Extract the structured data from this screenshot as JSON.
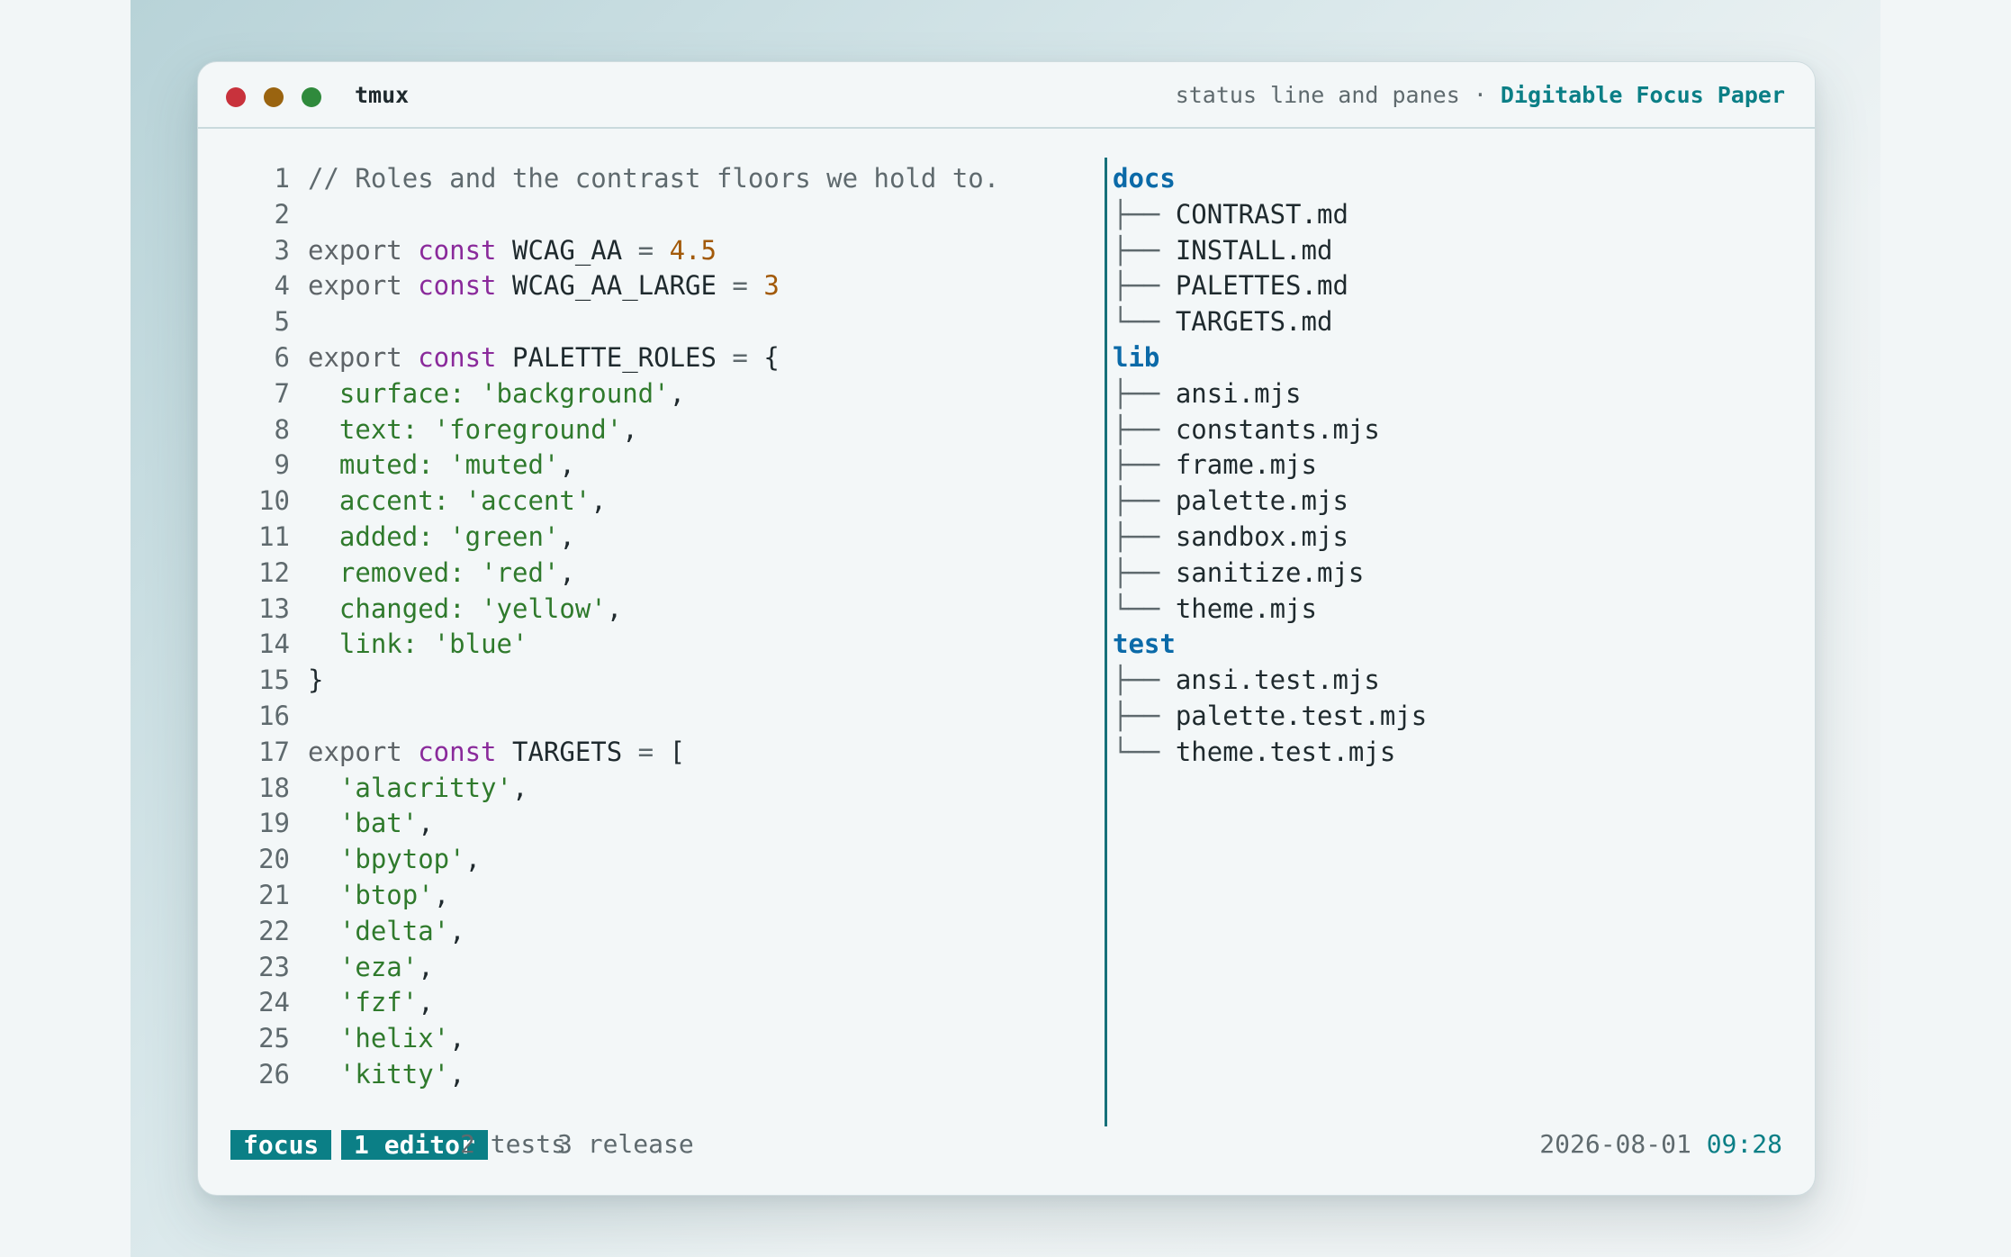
{
  "window": {
    "title": "tmux",
    "subtitle": "status line and panes",
    "separator": " · ",
    "theme_name": "Digitable Focus Paper"
  },
  "editor": {
    "lines": [
      {
        "n": "1",
        "tokens": [
          [
            "cm",
            "// Roles and the contrast floors we hold to."
          ]
        ]
      },
      {
        "n": "2",
        "tokens": []
      },
      {
        "n": "3",
        "tokens": [
          [
            "kw",
            "export "
          ],
          [
            "kw2",
            "const "
          ],
          [
            "id",
            "WCAG_AA "
          ],
          [
            "op",
            "= "
          ],
          [
            "num",
            "4.5"
          ]
        ]
      },
      {
        "n": "4",
        "tokens": [
          [
            "kw",
            "export "
          ],
          [
            "kw2",
            "const "
          ],
          [
            "id",
            "WCAG_AA_LARGE "
          ],
          [
            "op",
            "= "
          ],
          [
            "num",
            "3"
          ]
        ]
      },
      {
        "n": "5",
        "tokens": []
      },
      {
        "n": "6",
        "tokens": [
          [
            "kw",
            "export "
          ],
          [
            "kw2",
            "const "
          ],
          [
            "id",
            "PALETTE_ROLES "
          ],
          [
            "op",
            "= "
          ],
          [
            "id",
            "{"
          ]
        ]
      },
      {
        "n": "7",
        "tokens": [
          [
            "str",
            "  surface: "
          ],
          [
            "str",
            "'background'"
          ],
          [
            "id",
            ","
          ]
        ]
      },
      {
        "n": "8",
        "tokens": [
          [
            "str",
            "  text: "
          ],
          [
            "str",
            "'foreground'"
          ],
          [
            "id",
            ","
          ]
        ]
      },
      {
        "n": "9",
        "tokens": [
          [
            "str",
            "  muted: "
          ],
          [
            "str",
            "'muted'"
          ],
          [
            "id",
            ","
          ]
        ]
      },
      {
        "n": "10",
        "tokens": [
          [
            "str",
            "  accent: "
          ],
          [
            "str",
            "'accent'"
          ],
          [
            "id",
            ","
          ]
        ]
      },
      {
        "n": "11",
        "tokens": [
          [
            "str",
            "  added: "
          ],
          [
            "str",
            "'green'"
          ],
          [
            "id",
            ","
          ]
        ]
      },
      {
        "n": "12",
        "tokens": [
          [
            "str",
            "  removed: "
          ],
          [
            "str",
            "'red'"
          ],
          [
            "id",
            ","
          ]
        ]
      },
      {
        "n": "13",
        "tokens": [
          [
            "str",
            "  changed: "
          ],
          [
            "str",
            "'yellow'"
          ],
          [
            "id",
            ","
          ]
        ]
      },
      {
        "n": "14",
        "tokens": [
          [
            "str",
            "  link: "
          ],
          [
            "str",
            "'blue'"
          ]
        ]
      },
      {
        "n": "15",
        "tokens": [
          [
            "id",
            "}"
          ]
        ]
      },
      {
        "n": "16",
        "tokens": []
      },
      {
        "n": "17",
        "tokens": [
          [
            "kw",
            "export "
          ],
          [
            "kw2",
            "const "
          ],
          [
            "id",
            "TARGETS "
          ],
          [
            "op",
            "= "
          ],
          [
            "id",
            "["
          ]
        ]
      },
      {
        "n": "18",
        "tokens": [
          [
            "str",
            "  'alacritty'"
          ],
          [
            "id",
            ","
          ]
        ]
      },
      {
        "n": "19",
        "tokens": [
          [
            "str",
            "  'bat'"
          ],
          [
            "id",
            ","
          ]
        ]
      },
      {
        "n": "20",
        "tokens": [
          [
            "str",
            "  'bpytop'"
          ],
          [
            "id",
            ","
          ]
        ]
      },
      {
        "n": "21",
        "tokens": [
          [
            "str",
            "  'btop'"
          ],
          [
            "id",
            ","
          ]
        ]
      },
      {
        "n": "22",
        "tokens": [
          [
            "str",
            "  'delta'"
          ],
          [
            "id",
            ","
          ]
        ]
      },
      {
        "n": "23",
        "tokens": [
          [
            "str",
            "  'eza'"
          ],
          [
            "id",
            ","
          ]
        ]
      },
      {
        "n": "24",
        "tokens": [
          [
            "str",
            "  'fzf'"
          ],
          [
            "id",
            ","
          ]
        ]
      },
      {
        "n": "25",
        "tokens": [
          [
            "str",
            "  'helix'"
          ],
          [
            "id",
            ","
          ]
        ]
      },
      {
        "n": "26",
        "tokens": [
          [
            "str",
            "  'kitty'"
          ],
          [
            "id",
            ","
          ]
        ]
      }
    ]
  },
  "file_tree": {
    "entries": [
      {
        "kind": "dir",
        "text": "docs"
      },
      {
        "kind": "file",
        "branch": "├── ",
        "text": "CONTRAST.md"
      },
      {
        "kind": "file",
        "branch": "├── ",
        "text": "INSTALL.md"
      },
      {
        "kind": "file",
        "branch": "├── ",
        "text": "PALETTES.md"
      },
      {
        "kind": "file",
        "branch": "└── ",
        "text": "TARGETS.md"
      },
      {
        "kind": "dir",
        "text": "lib"
      },
      {
        "kind": "file",
        "branch": "├── ",
        "text": "ansi.mjs"
      },
      {
        "kind": "file",
        "branch": "├── ",
        "text": "constants.mjs"
      },
      {
        "kind": "file",
        "branch": "├── ",
        "text": "frame.mjs"
      },
      {
        "kind": "file",
        "branch": "├── ",
        "text": "palette.mjs"
      },
      {
        "kind": "file",
        "branch": "├── ",
        "text": "sandbox.mjs"
      },
      {
        "kind": "file",
        "branch": "├── ",
        "text": "sanitize.mjs"
      },
      {
        "kind": "file",
        "branch": "└── ",
        "text": "theme.mjs"
      },
      {
        "kind": "dir",
        "text": "test"
      },
      {
        "kind": "file",
        "branch": "├── ",
        "text": "ansi.test.mjs"
      },
      {
        "kind": "file",
        "branch": "├── ",
        "text": "palette.test.mjs"
      },
      {
        "kind": "file",
        "branch": "└── ",
        "text": "theme.test.mjs"
      }
    ]
  },
  "status_bar": {
    "session": "focus",
    "active_window": "1 editor",
    "windows": [
      "2 tests",
      "3 release"
    ],
    "date": "2026-08-01",
    "time": "09:28"
  },
  "colors": {
    "accent": "#0b7f86",
    "directory": "#0b6aa8",
    "string": "#2f7a2c",
    "number": "#a25a0a",
    "keyword": "#8a2a9b",
    "muted": "#5f6a6e",
    "foreground": "#1f2a2e",
    "background": "#f3f7f8"
  }
}
